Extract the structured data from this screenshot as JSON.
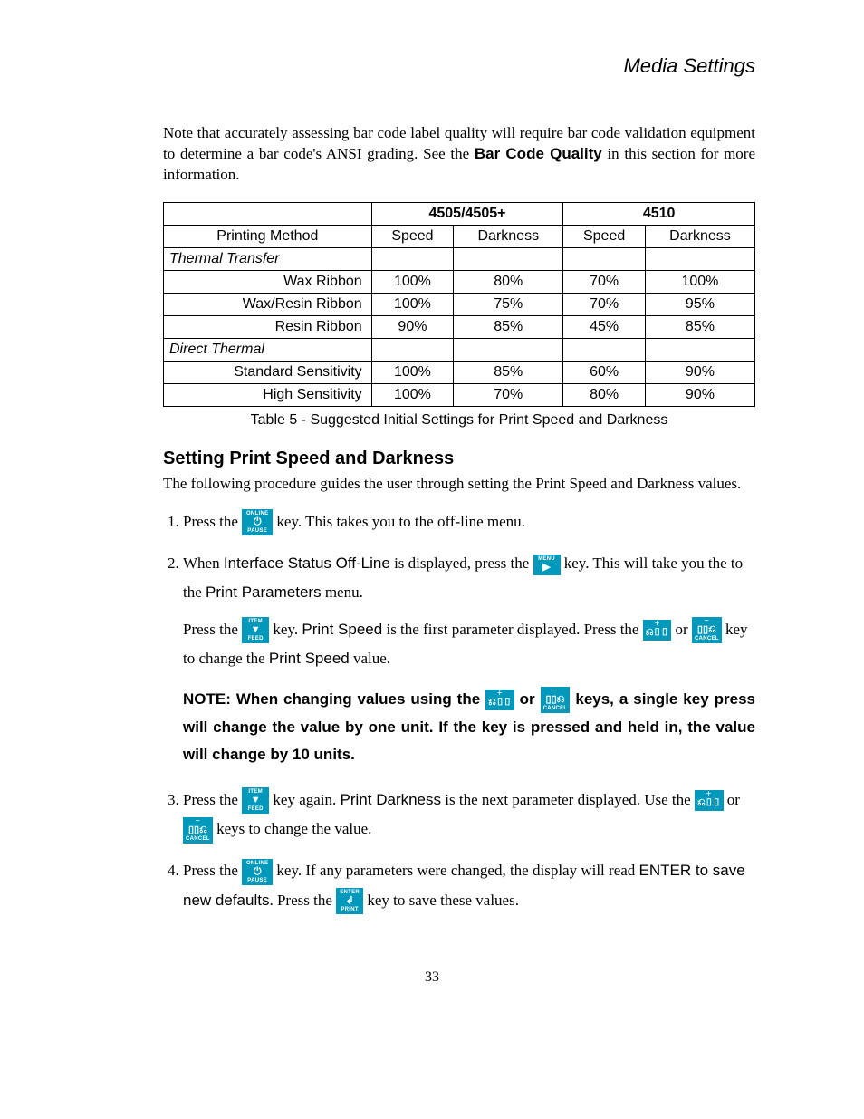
{
  "header": {
    "title": "Media Settings"
  },
  "intro": {
    "text_before_bold": "Note that accurately assessing bar code label quality will require bar code validation equipment to determine a bar code's ANSI grading. See the ",
    "bold": "Bar Code Quality",
    "text_after_bold": " in this section for more information."
  },
  "chart_data": {
    "type": "table",
    "title": "Table 5 - Suggested Initial Settings for Print Speed and Darkness",
    "model_groups": [
      "4505/4505+",
      "4510"
    ],
    "sub_columns": [
      "Speed",
      "Darkness"
    ],
    "row_header_label": "Printing Method",
    "sections": [
      {
        "name": "Thermal Transfer",
        "rows": [
          {
            "label": "Wax Ribbon",
            "values": [
              "100%",
              "80%",
              "70%",
              "100%"
            ]
          },
          {
            "label": "Wax/Resin Ribbon",
            "values": [
              "100%",
              "75%",
              "70%",
              "95%"
            ]
          },
          {
            "label": "Resin Ribbon",
            "values": [
              "90%",
              "85%",
              "45%",
              "85%"
            ]
          }
        ]
      },
      {
        "name": "Direct Thermal",
        "rows": [
          {
            "label": "Standard Sensitivity",
            "values": [
              "100%",
              "85%",
              "60%",
              "90%"
            ]
          },
          {
            "label": "High Sensitivity",
            "values": [
              "100%",
              "70%",
              "80%",
              "90%"
            ]
          }
        ]
      }
    ]
  },
  "section": {
    "heading": "Setting Print Speed and Darkness",
    "lead": "The following procedure guides the user through setting the Print Speed and Darkness values."
  },
  "keys": {
    "online_pause": {
      "top": "ONLINE",
      "mid": "⏻",
      "bot": "PAUSE"
    },
    "menu": {
      "top": "MENU",
      "mid": "▶",
      "bot": ""
    },
    "item_feed": {
      "top": "ITEM",
      "mid": "▼",
      "bot": "FEED"
    },
    "plus": {
      "top": "＋",
      "mid": "⎌▯▯",
      "bot": ""
    },
    "minus_cancel": {
      "top": "－",
      "mid": "▯▯⎌",
      "bot": "CANCEL"
    },
    "enter_print": {
      "top": "ENTER",
      "mid": "↲",
      "bot": "PRINT"
    }
  },
  "steps": {
    "s1": {
      "before_key": "Press the ",
      "after_key": " key. This takes you to the off-line menu."
    },
    "s2": {
      "p1_a": "When ",
      "p1_bold": "Interface Status Off-Line",
      "p1_b": " is displayed, press the ",
      "p1_c": " key. This will take you the to the ",
      "p1_d": "Print Parameters",
      "p1_e": " menu.",
      "p2_a": "Press the ",
      "p2_b": " key. ",
      "p2_c": "Print Speed",
      "p2_d": " is the first parameter displayed. Press the ",
      "p2_e": " or ",
      "p2_f": " key to change the ",
      "p2_g": "Print Speed",
      "p2_h": " value."
    },
    "note": {
      "a": "NOTE: When changing values using the ",
      "b": " or ",
      "c": " keys, a single key press will change the value by one unit. If the key is pressed and held in, the value will change by 10 units."
    },
    "s3": {
      "a": "Press the ",
      "b": " key again. ",
      "c": "Print Darkness",
      "d": " is the next parameter displayed. Use the ",
      "e": " or ",
      "f": " keys to change the value."
    },
    "s4": {
      "a": "Press the ",
      "b": " key. If any parameters were changed, the display will read ",
      "c": "ENTER to save new defaults",
      "d": ". Press the ",
      "e": " key to save these values."
    }
  },
  "page_number": "33"
}
